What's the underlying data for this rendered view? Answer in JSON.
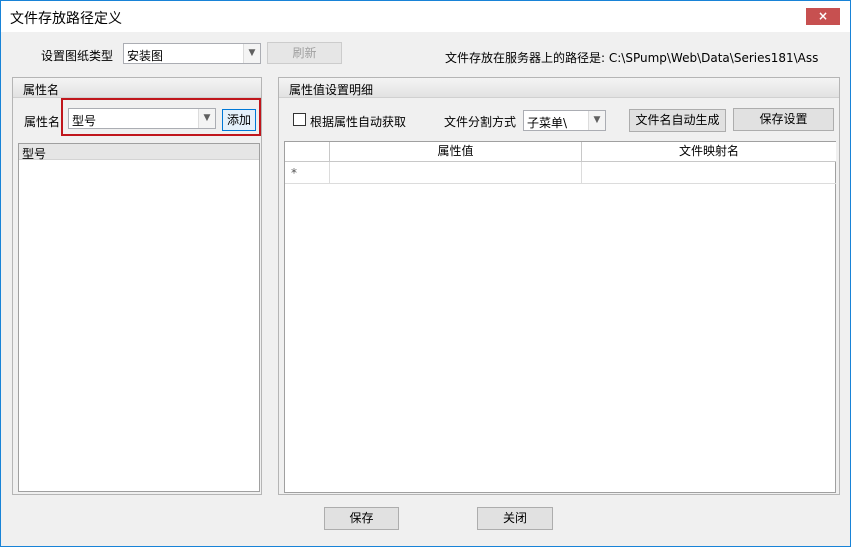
{
  "window": {
    "title": "文件存放路径定义",
    "close_glyph": "×"
  },
  "top": {
    "drawing_type_label": "设置图纸类型",
    "drawing_type_value": "安装图",
    "refresh_label": "刷新",
    "server_path_text": "文件存放在服务器上的路径是: C:\\SPump\\Web\\Data\\Series181\\Ass"
  },
  "left_panel": {
    "header": "属性名",
    "attr_label": "属性名",
    "attr_value": "型号",
    "add_label": "添加",
    "list_header": "型号"
  },
  "right_panel": {
    "header": "属性值设置明细",
    "auto_get_label": "根据属性自动获取",
    "split_label": "文件分割方式",
    "split_value": "子菜单\\",
    "auto_name_label": "文件名自动生成",
    "save_settings_label": "保存设置",
    "grid": {
      "columns": [
        "属性值",
        "文件映射名"
      ],
      "new_row_marker": "*"
    }
  },
  "footer": {
    "save_label": "保存",
    "close_label": "关闭"
  },
  "icons": {
    "dropdown_arrow": "chevron-down-icon"
  }
}
